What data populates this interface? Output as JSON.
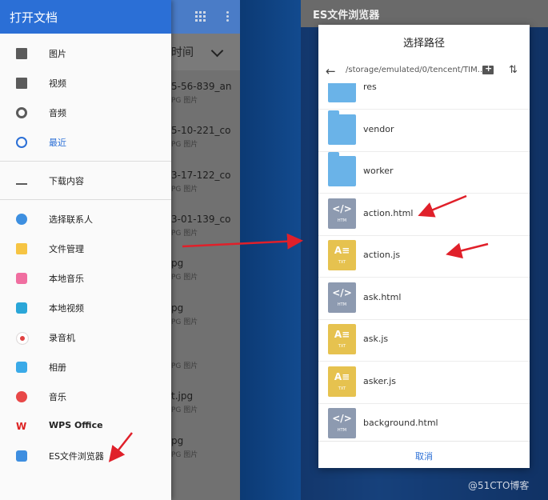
{
  "drawer": {
    "title": "打开文档",
    "groups": [
      [
        {
          "label": "图片",
          "icon": "image-icon",
          "active": false
        },
        {
          "label": "视频",
          "icon": "video-icon",
          "active": false
        },
        {
          "label": "音频",
          "icon": "audio-icon",
          "active": false
        },
        {
          "label": "最近",
          "icon": "clock-icon",
          "active": true
        }
      ],
      [
        {
          "label": "下载内容",
          "icon": "download-icon",
          "active": false
        }
      ],
      [
        {
          "label": "选择联系人",
          "icon": "contacts-icon",
          "active": false
        },
        {
          "label": "文件管理",
          "icon": "folder-icon",
          "active": false
        },
        {
          "label": "本地音乐",
          "icon": "music-app-icon",
          "active": false
        },
        {
          "label": "本地视频",
          "icon": "video-app-icon",
          "active": false
        },
        {
          "label": "录音机",
          "icon": "recorder-icon",
          "active": false
        },
        {
          "label": "相册",
          "icon": "gallery-icon",
          "active": false
        },
        {
          "label": "音乐",
          "icon": "music-icon",
          "active": false
        },
        {
          "label": "WPS Office",
          "icon": "wps-icon",
          "active": false
        },
        {
          "label": "ES文件浏览器",
          "icon": "es-explorer-icon",
          "active": false
        }
      ]
    ]
  },
  "background_list": {
    "sort_label": "时间",
    "files": [
      {
        "name": "5-56-839_an",
        "meta": "PG 图片"
      },
      {
        "name": "5-10-221_co",
        "meta": "PG 图片"
      },
      {
        "name": "3-17-122_co",
        "meta": "PG 图片"
      },
      {
        "name": "3-01-139_co",
        "meta": "PG 图片"
      },
      {
        "name": "pg",
        "meta": "PG 图片"
      },
      {
        "name": "pg",
        "meta": "PG 图片"
      },
      {
        "name": "",
        "meta": "PG 图片"
      },
      {
        "name": "t.jpg",
        "meta": "PG 图片"
      },
      {
        "name": "pg",
        "meta": "PG 图片"
      }
    ]
  },
  "window": {
    "title": "ES文件浏览器"
  },
  "dialog": {
    "title": "选择路径",
    "path": "/storage/emulated/0/tencent/TIM...",
    "cancel_label": "取消",
    "files": [
      {
        "name": "res",
        "type": "folder"
      },
      {
        "name": "vendor",
        "type": "folder"
      },
      {
        "name": "worker",
        "type": "folder"
      },
      {
        "name": "action.html",
        "type": "html"
      },
      {
        "name": "action.js",
        "type": "js"
      },
      {
        "name": "ask.html",
        "type": "html"
      },
      {
        "name": "ask.js",
        "type": "js"
      },
      {
        "name": "asker.js",
        "type": "js"
      },
      {
        "name": "background.html",
        "type": "html"
      }
    ]
  },
  "icon_tags": {
    "html": "HTM",
    "js": "TXT"
  },
  "watermark": "@51CTO博客",
  "colors": {
    "accent": "#2b6fd6",
    "arrow": "#e0202a",
    "folder": "#6ab3e8",
    "html_file": "#8d9ab0",
    "js_file": "#e6c24f"
  }
}
